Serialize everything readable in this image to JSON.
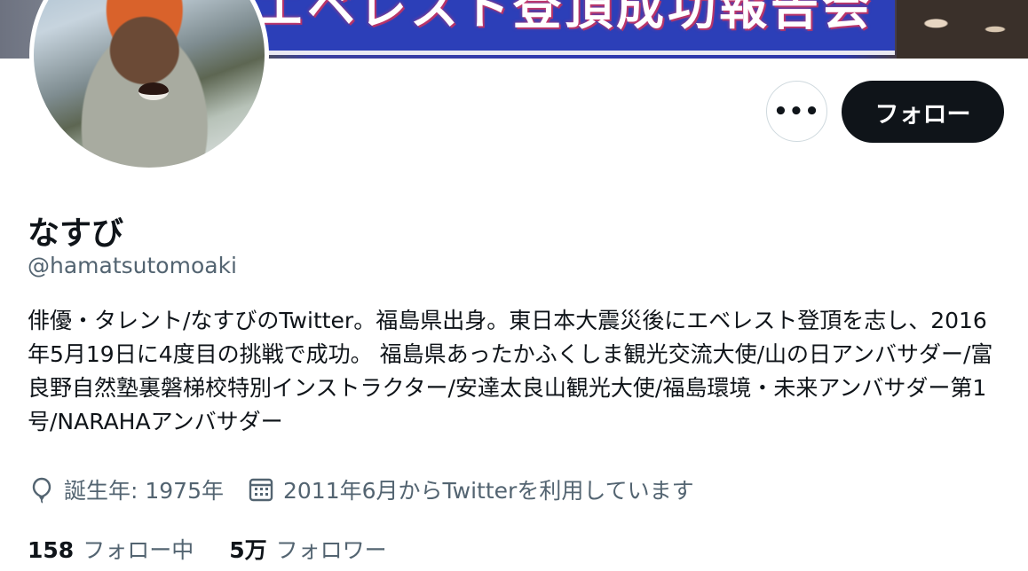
{
  "banner": {
    "sign_text": "エベレスト登頂成功報告会"
  },
  "actions": {
    "more_label": "•••",
    "follow_label": "フォロー"
  },
  "profile": {
    "name": "なすび",
    "handle": "@hamatsutomoaki",
    "bio": "俳優・タレント/なすびのTwitter。福島県出身。東日本大震災後にエベレスト登頂を志し、2016年5月19日に4度目の挑戦で成功。 福島県あったかふくしま観光交流大使/山の日アンバサダー/富良野自然塾裏磐梯校特別インストラクター/安達太良山観光大使/福島環境・未来アンバサダー第1号/NARAHAアンバサダー"
  },
  "meta": {
    "birth_icon": "balloon-icon",
    "birth_text": "誕生年: 1975年",
    "joined_icon": "calendar-icon",
    "joined_text": "2011年6月からTwitterを利用しています"
  },
  "counts": {
    "following_num": "158",
    "following_label": "フォロー中",
    "followers_num": "5万",
    "followers_label": "フォロワー"
  },
  "colors": {
    "primary_text": "#0f1419",
    "secondary_text": "#536471",
    "border": "#cfd9de",
    "follow_button_bg": "#0f1419"
  }
}
